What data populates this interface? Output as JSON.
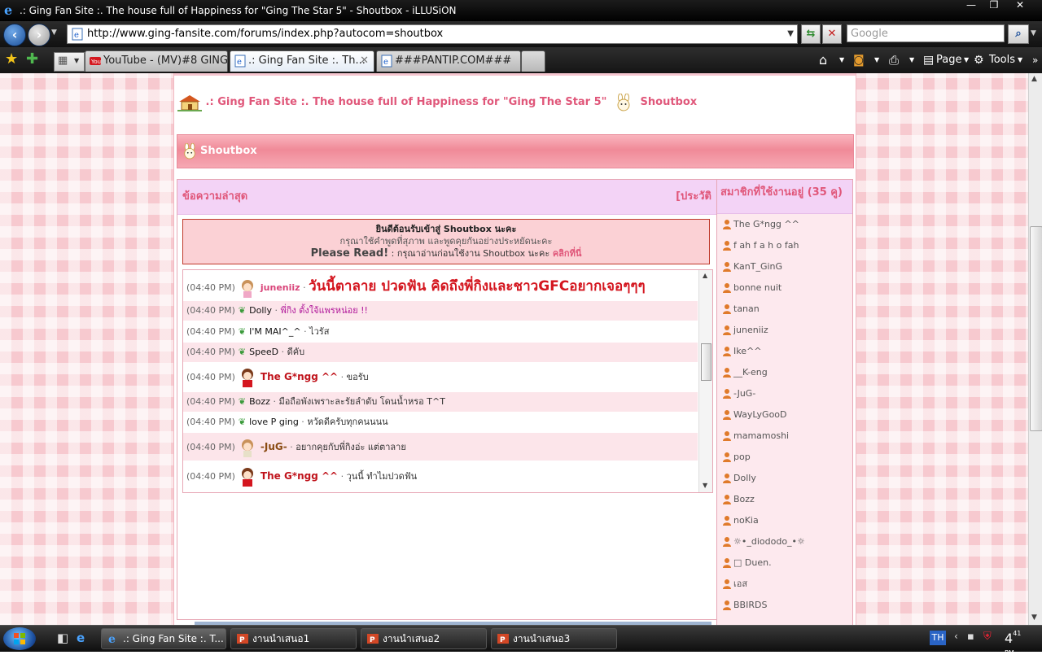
{
  "window": {
    "title": ".: Ging Fan Site :. The house full of Happiness for \"Ging The Star 5\" - Shoutbox - iLLUSiON",
    "min": "—",
    "max": "❐",
    "close": "✕"
  },
  "address_bar": {
    "url": "http://www.ging-fansite.com/forums/index.php?autocom=shoutbox",
    "search_placeholder": "Google"
  },
  "tabs": [
    {
      "label": "YouTube - (MV)#8 GING..."
    },
    {
      "label": ".: Ging Fan Site :. Th..."
    },
    {
      "label": "###PANTIP.COM###"
    }
  ],
  "command_bar": {
    "page": "Page",
    "tools": "Tools"
  },
  "breadcrumb": {
    "site": ".: Ging Fan Site :. The house full of Happiness for \"Ging The Star 5\"",
    "section": "Shoutbox"
  },
  "shoutbox": {
    "header": "Shoutbox",
    "latest_label": "ข้อความล่าสุด",
    "history_label": "[ประวัติ",
    "welcome_line1": "ยินดีต้อนรับเข้าสู่ Shoutbox นะคะ",
    "welcome_line2": "กรุณาใช้คำพูดที่สุภาพ และพูดคุยกันอย่างประหยัดนะคะ",
    "welcome_please": "Please Read!",
    "welcome_line3": " : กรุณาอ่านก่อนใช้งาน Shoutbox นะคะ ",
    "welcome_link": "คลิกที่นี่",
    "messages": [
      {
        "time": "(04:40 PM)",
        "user": "juneniiz",
        "sep": " · ",
        "text": "วันนี้ตาลาย ปวดฟัน คิดถึงพี่กิงและชาวGFCอยากเจอๆๆๆ"
      },
      {
        "time": "(04:40 PM)",
        "user": "Dolly",
        "sep": " · ",
        "text": "พี่กิง ตั้งใจ้แพรหน่อย !!"
      },
      {
        "time": "(04:40 PM)",
        "user": "I'M MAI^_^",
        "sep": " · ",
        "text": "ไวรัส"
      },
      {
        "time": "(04:40 PM)",
        "user": "SpeeD",
        "sep": " · ",
        "text": "ดีคับ"
      },
      {
        "time": "(04:40 PM)",
        "user": "The G*ngg ^^",
        "sep": " · ",
        "text": "ขอรับ"
      },
      {
        "time": "(04:40 PM)",
        "user": "Bozz",
        "sep": " · ",
        "text": "มือถือพังเพราะละรัยลำดับ โดนน้ำหรอ T^T"
      },
      {
        "time": "(04:40 PM)",
        "user": "love P ging",
        "sep": " · ",
        "text": "หวัดดีครับทุกคนนนน"
      },
      {
        "time": "(04:40 PM)",
        "user": "-JuG-",
        "sep": " · ",
        "text": "อยากคุยกับพี่กิงอ่ะ แต่ตาลาย"
      },
      {
        "time": "(04:40 PM)",
        "user": "The G*ngg ^^",
        "sep": " · ",
        "text": "วุนนี้ ทำไมปวดฟัน"
      }
    ],
    "members_label": "สมาชิกที่ใช้งานอยู่ (35 คู)",
    "members": [
      "The G*ngg ^^",
      "f ah f a h o fah",
      "KanT_GinG",
      "bonne nuit",
      "tanan",
      "juneniiz",
      "Ike^^",
      "__K-eng",
      "-JuG-",
      "WayLyGooD",
      "mamamoshi",
      "pop",
      "Dolly",
      "Bozz",
      "noKia",
      "☼•_diododo_•☼",
      "□ Duen.",
      "เอส",
      "BBIRDS"
    ]
  },
  "taskbar": {
    "items": [
      {
        "label": ".: Ging Fan Site :. T..."
      },
      {
        "label": "งานนำเสนอ1"
      },
      {
        "label": "งานนำเสนอ2"
      },
      {
        "label": "งานนำเสนอ3"
      }
    ],
    "lang": "TH",
    "clock": "4",
    "clock_min": "41",
    "clock_pm": "PM"
  },
  "colors": {
    "accent_pink": "#e0577a",
    "shout_red": "#d4161f",
    "panel_lilac": "#f3d3f6"
  }
}
